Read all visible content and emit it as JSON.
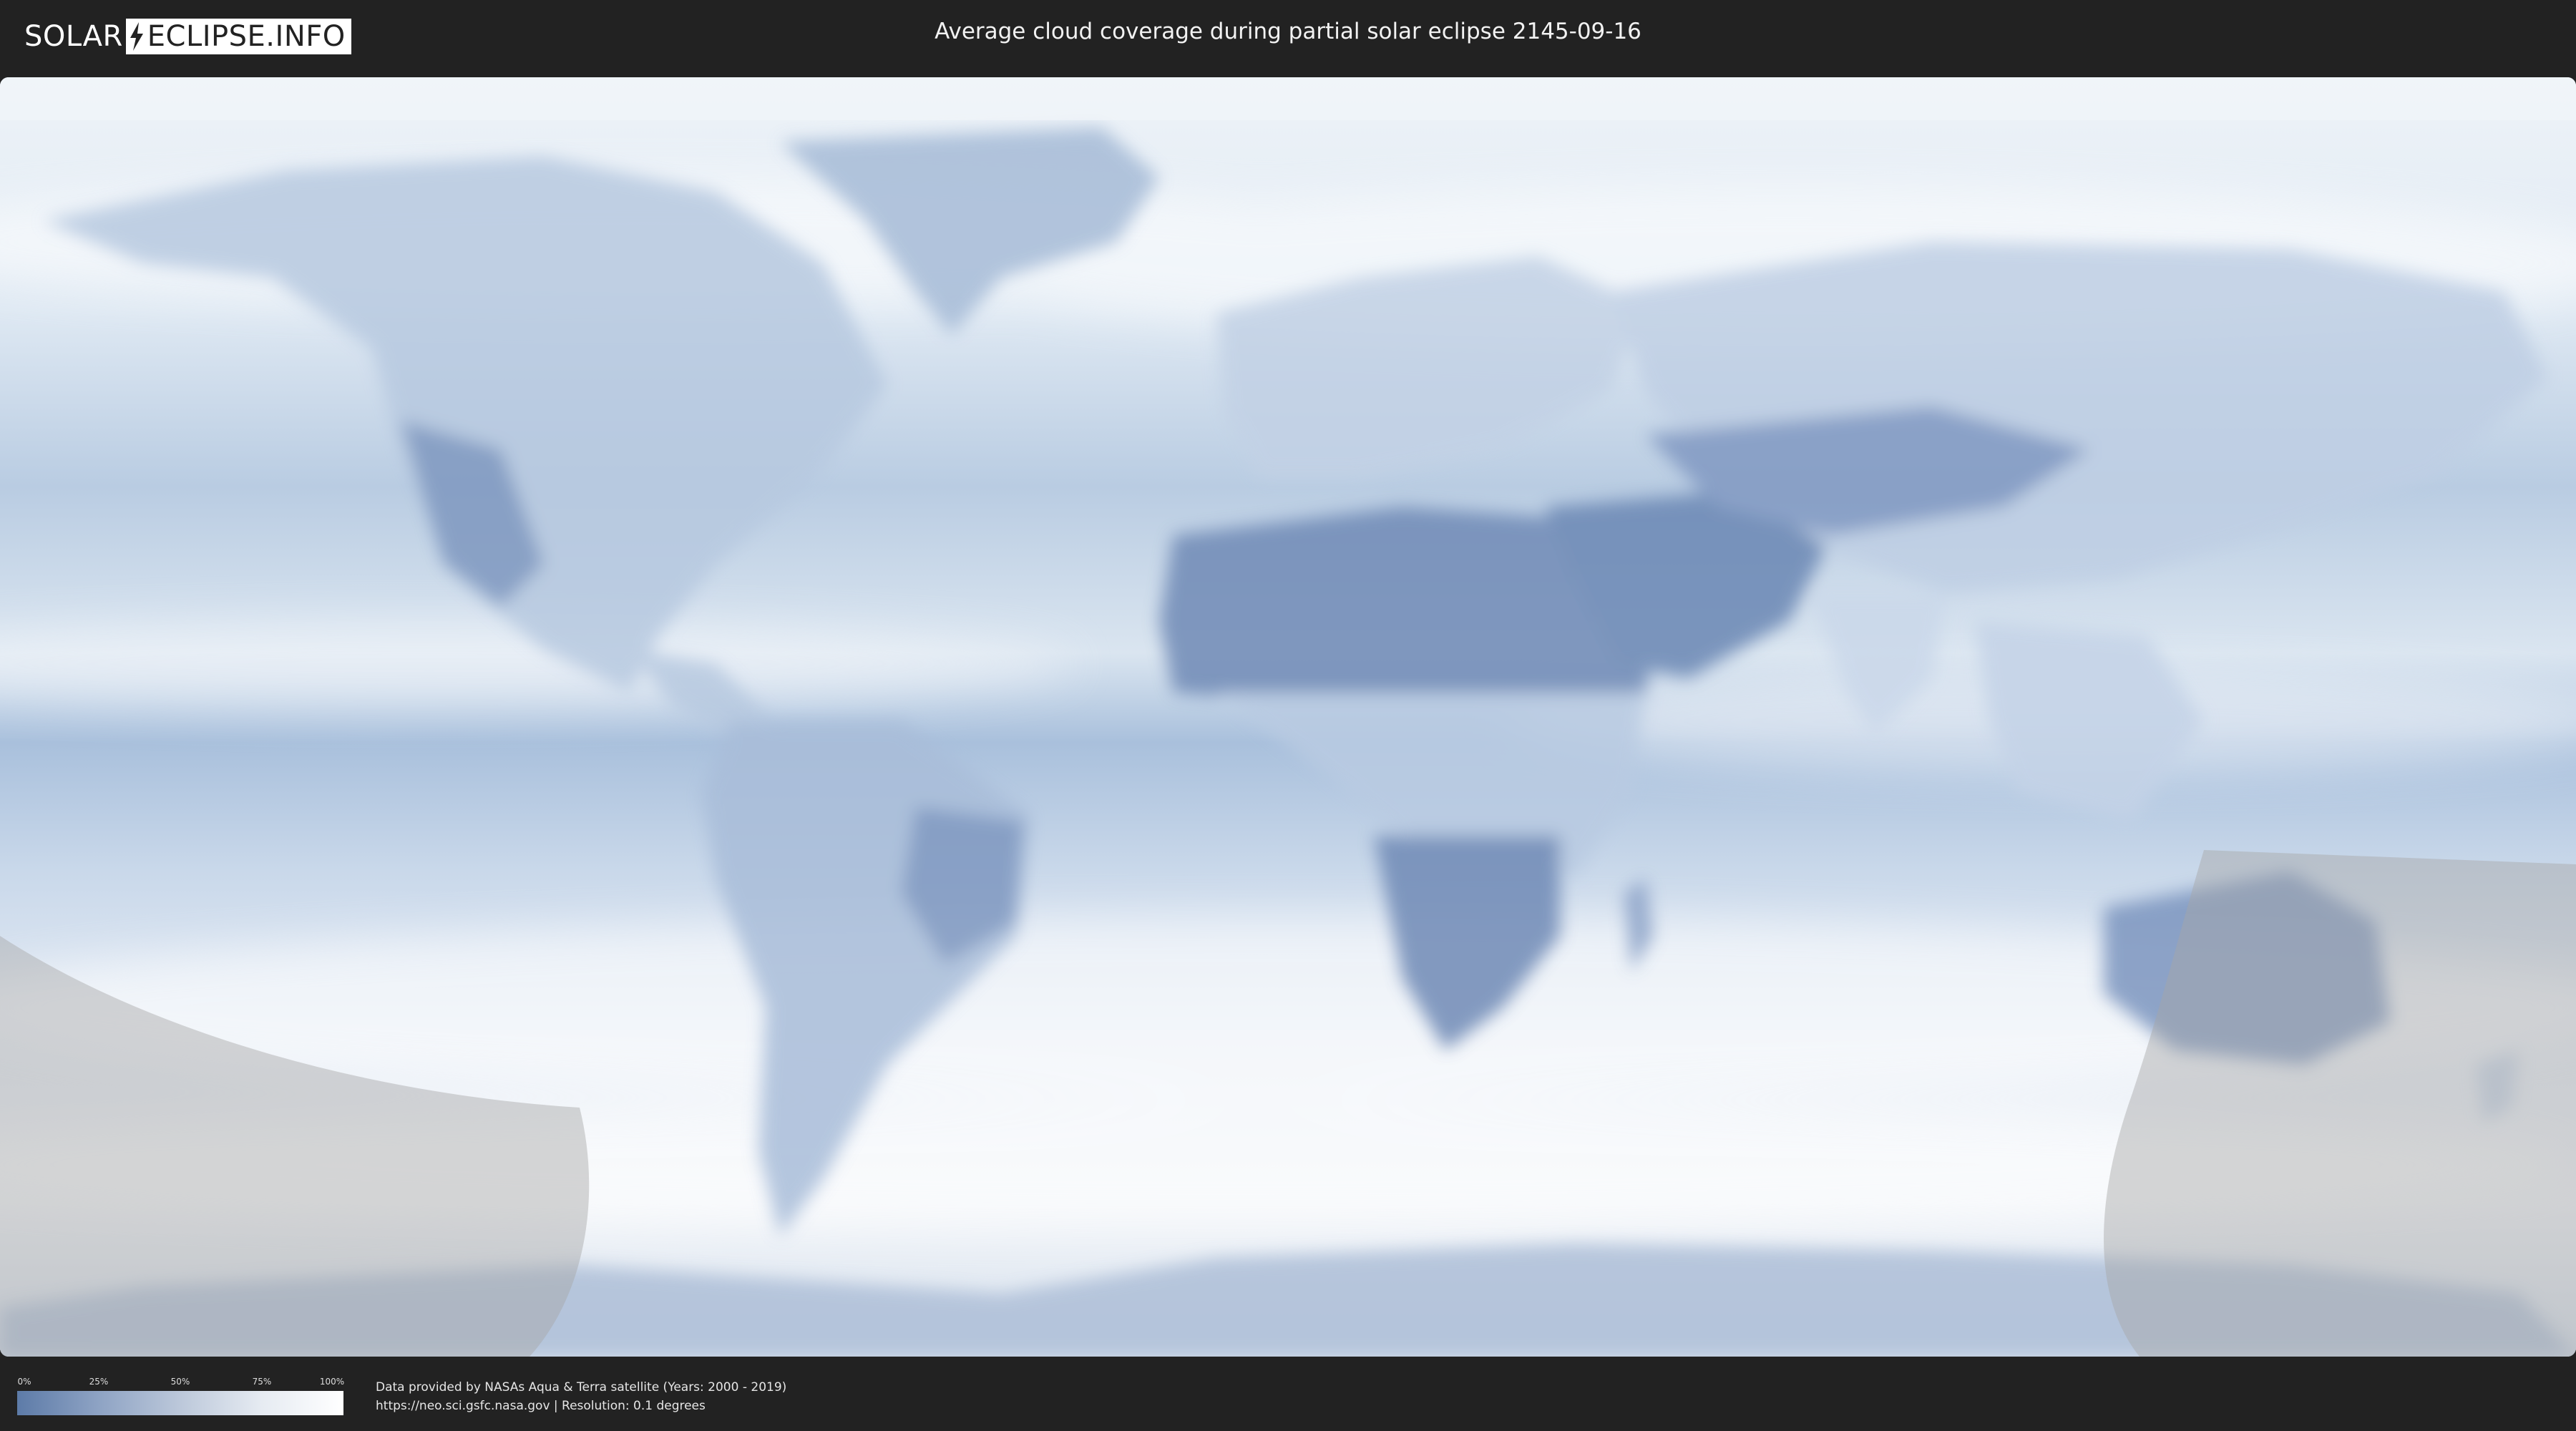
{
  "header": {
    "logo_left": "SOLAR",
    "logo_right": "ECLIPSE.INFO",
    "title": "Average cloud coverage during partial solar eclipse 2145-09-16"
  },
  "legend": {
    "ticks": [
      "0%",
      "25%",
      "50%",
      "75%",
      "100%"
    ],
    "colors": [
      "#5d7ba8",
      "#8ea3c4",
      "#bcc8da",
      "#e6ebf2",
      "#ffffff"
    ]
  },
  "credits": {
    "line1": "Data provided by NASAs Aqua & Terra satellite (Years: 2000 - 2019)",
    "line2": "https://neo.sci.gsfc.nasa.gov | Resolution: 0.1 degrees"
  },
  "map": {
    "projection": "equirectangular",
    "clear_color": "#5d7ba8",
    "cloudy_color": "#ffffff",
    "eclipse_overlay_color": "#9a9a9a"
  }
}
